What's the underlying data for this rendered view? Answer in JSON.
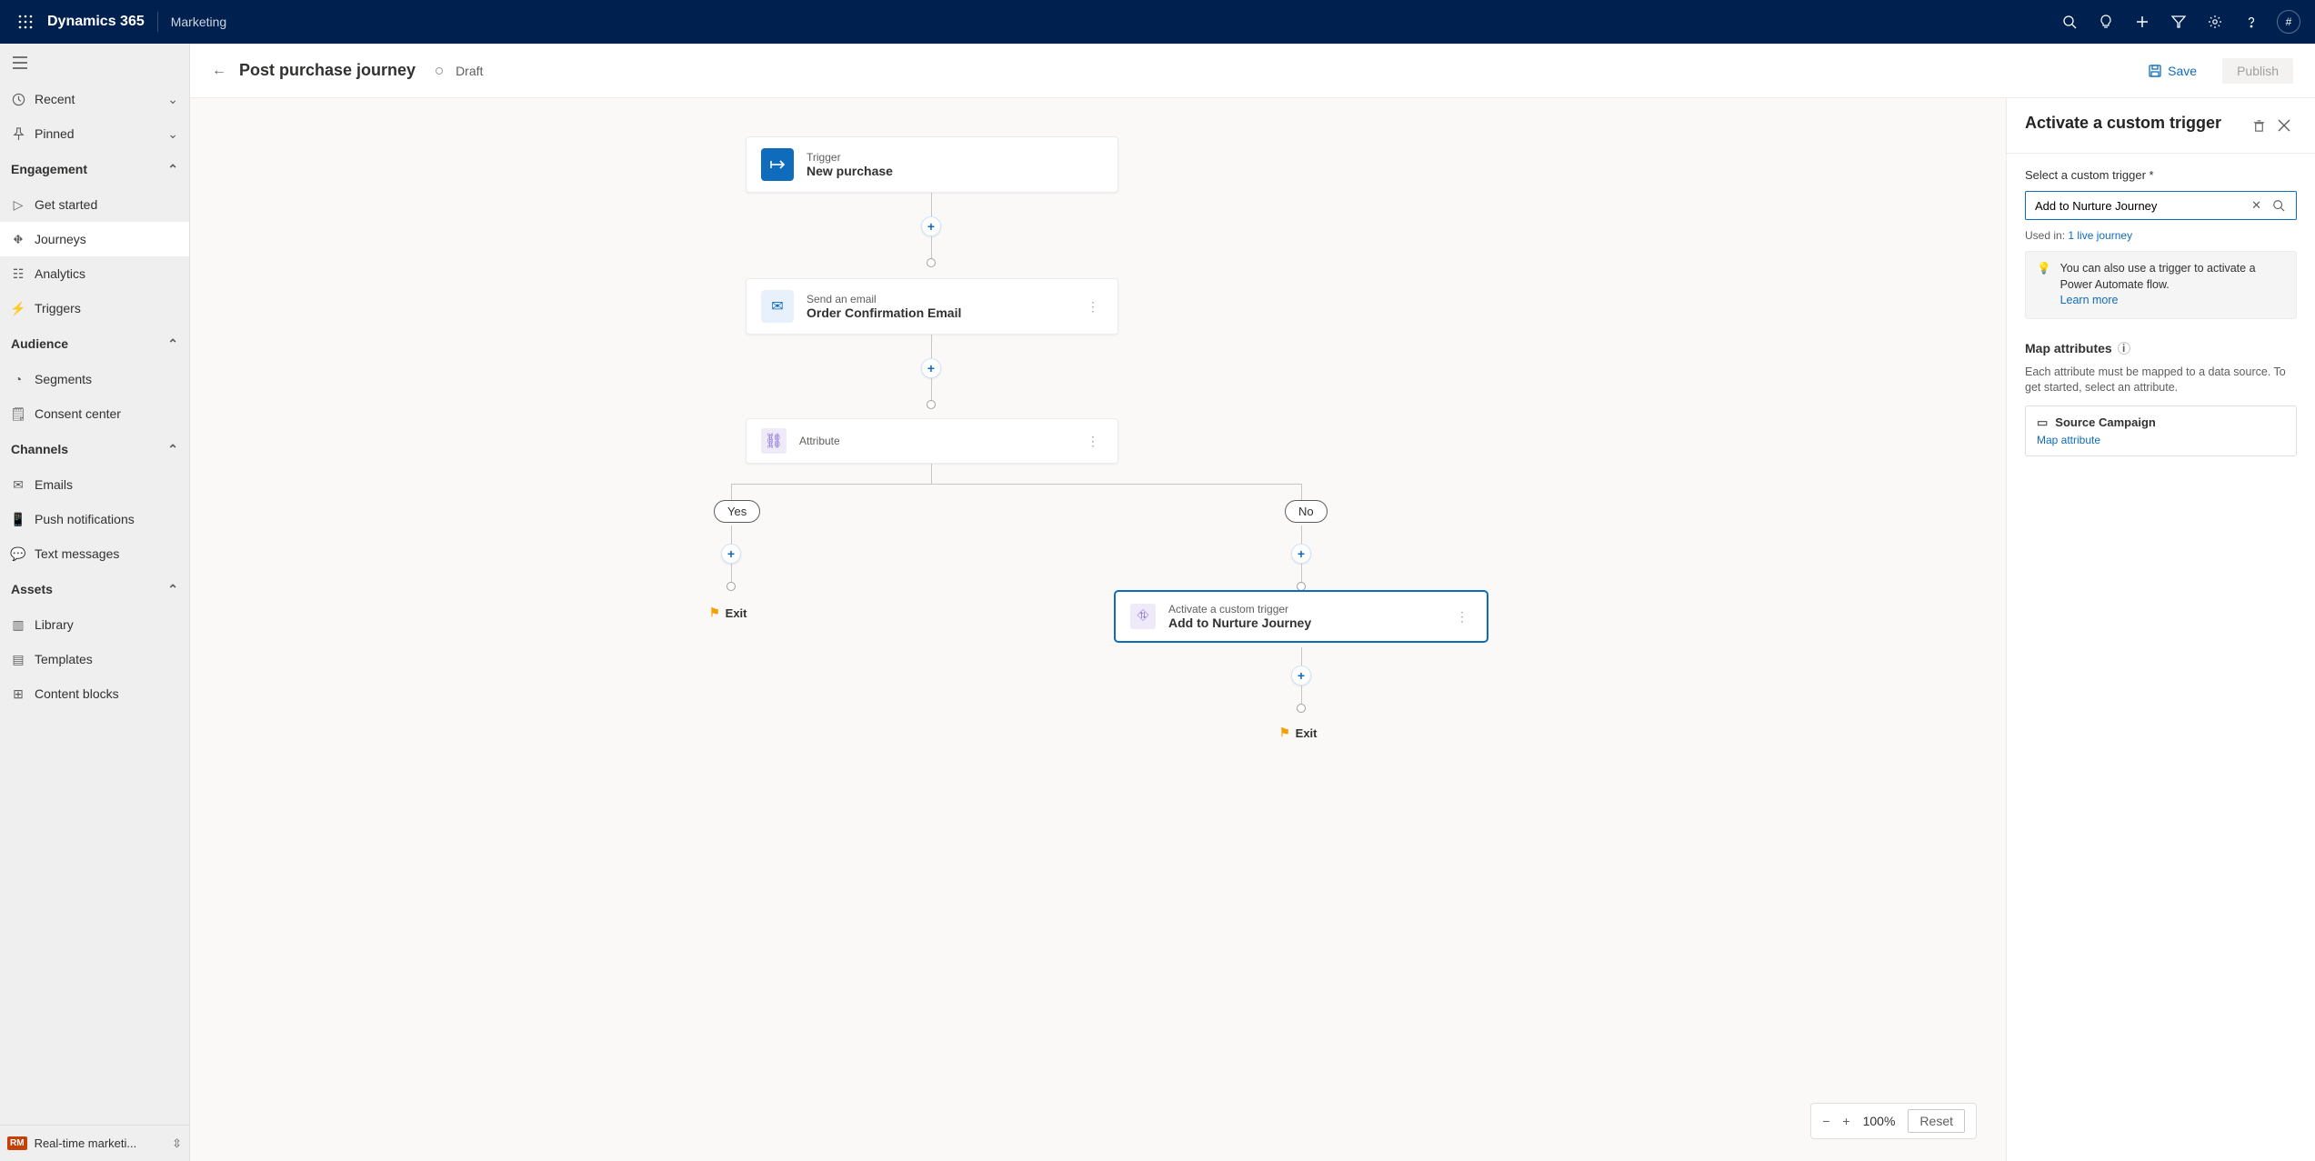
{
  "topbar": {
    "brand": "Dynamics 365",
    "module": "Marketing",
    "avatar_initial": "#"
  },
  "leftnav": {
    "recent": "Recent",
    "pinned": "Pinned",
    "groups": {
      "engagement": "Engagement",
      "audience": "Audience",
      "channels": "Channels",
      "assets": "Assets"
    },
    "items": {
      "get_started": "Get started",
      "journeys": "Journeys",
      "analytics": "Analytics",
      "triggers": "Triggers",
      "segments": "Segments",
      "consent": "Consent center",
      "emails": "Emails",
      "push": "Push notifications",
      "text": "Text messages",
      "library": "Library",
      "templates": "Templates",
      "blocks": "Content blocks"
    },
    "area": {
      "badge": "RM",
      "label": "Real-time marketi..."
    }
  },
  "cmdbar": {
    "title": "Post purchase journey",
    "status": "Draft",
    "save": "Save",
    "publish": "Publish"
  },
  "canvas": {
    "trigger": {
      "sub": "Trigger",
      "title": "New purchase"
    },
    "email": {
      "sub": "Send an email",
      "title": "Order Confirmation Email"
    },
    "attr": {
      "title": "Attribute"
    },
    "branches": {
      "yes": "Yes",
      "no": "No"
    },
    "custom": {
      "sub": "Activate a custom trigger",
      "title": "Add to Nurture Journey"
    },
    "exit": "Exit"
  },
  "zoom": {
    "level": "100%",
    "reset": "Reset"
  },
  "panel": {
    "title": "Activate a custom trigger",
    "select_label": "Select a custom trigger *",
    "combo_value": "Add to Nurture Journey",
    "used_in_prefix": "Used in: ",
    "used_in_link": "1 live journey",
    "info_text": "You can also use a trigger to activate a Power Automate flow.",
    "info_link": "Learn more",
    "map_title": "Map attributes",
    "map_helper": "Each attribute must be mapped to a data source. To get started, select an attribute.",
    "attr_name": "Source Campaign",
    "attr_link": "Map attribute"
  }
}
